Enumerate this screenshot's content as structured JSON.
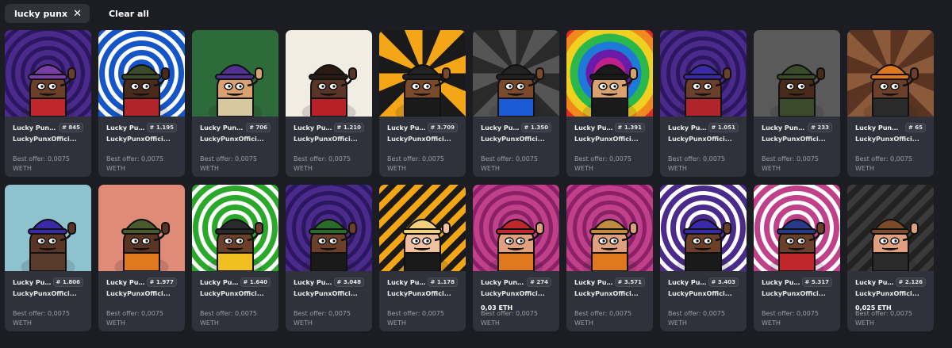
{
  "filters": {
    "chip_label": "lucky punx",
    "clear_label": "Clear all"
  },
  "cards": [
    {
      "name": "Lucky Punx ...",
      "num": "# 845",
      "coll": "LuckyPunxOffici...",
      "price": "",
      "offer": "Best offer: 0,0075",
      "cur": "WETH",
      "bg": "#4a2a8a",
      "bg2": "#2a1760",
      "pattern": "spiral",
      "hat": "#7a3ea8",
      "shirt": "#c0272d",
      "skin": "#6b3f2a"
    },
    {
      "name": "Lucky Punx...",
      "num": "# 1.195",
      "coll": "LuckyPunxOffici...",
      "price": "",
      "offer": "Best offer: 0,0075",
      "cur": "WETH",
      "bg": "#1456c8",
      "bg2": "#ffffff",
      "pattern": "spiral",
      "hat": "#3a4a2a",
      "shirt": "#b0242a",
      "skin": "#4a2a1a"
    },
    {
      "name": "Lucky Punx ...",
      "num": "# 706",
      "coll": "LuckyPunxOffici...",
      "price": "",
      "offer": "Best offer: 0,0075",
      "cur": "WETH",
      "bg": "#2d6b3a",
      "bg2": "#2d6b3a",
      "pattern": "flat",
      "hat": "#503090",
      "shirt": "#d7c8a0",
      "skin": "#d9a070"
    },
    {
      "name": "Lucky Punx...",
      "num": "# 1.210",
      "coll": "LuckyPunxOffici...",
      "price": "",
      "offer": "Best offer: 0,0075",
      "cur": "WETH",
      "bg": "#f1ede2",
      "bg2": "#f1ede2",
      "pattern": "flat",
      "hat": "#2a1a14",
      "shirt": "#b82028",
      "skin": "#5a3525"
    },
    {
      "name": "Lucky Punx...",
      "num": "# 3.709",
      "coll": "LuckyPunxOffici...",
      "price": "",
      "offer": "Best offer: 0,0075",
      "cur": "WETH",
      "bg": "#f4a617",
      "bg2": "#1a1a1a",
      "pattern": "rays",
      "hat": "#222222",
      "shirt": "#1a1a1a",
      "skin": "#7a4a2a"
    },
    {
      "name": "Lucky Punx...",
      "num": "# 1.350",
      "coll": "LuckyPunxOffici...",
      "price": "",
      "offer": "Best offer: 0,0075",
      "cur": "WETH",
      "bg": "#555555",
      "bg2": "#2a2a2a",
      "pattern": "rays",
      "hat": "#222222",
      "shirt": "#1b5bd6",
      "skin": "#7a4a2a"
    },
    {
      "name": "Lucky Punx...",
      "num": "# 1.391",
      "coll": "LuckyPunxOffici...",
      "price": "",
      "offer": "Best offer: 0,0075",
      "cur": "WETH",
      "bg": "#e02a2a",
      "bg2": "#6a1ba8",
      "pattern": "rainbow",
      "hat": "#1a1a1a",
      "shirt": "#1a1a1a",
      "skin": "#d9a070"
    },
    {
      "name": "Lucky Punx...",
      "num": "# 1.051",
      "coll": "LuckyPunxOffici...",
      "price": "",
      "offer": "Best offer: 0,0075",
      "cur": "WETH",
      "bg": "#4a2a8a",
      "bg2": "#2a1760",
      "pattern": "spiral",
      "hat": "#3a2aa8",
      "shirt": "#b0242a",
      "skin": "#6b3f2a"
    },
    {
      "name": "Lucky Punx ...",
      "num": "# 233",
      "coll": "LuckyPunxOffici...",
      "price": "",
      "offer": "Best offer: 0,0075",
      "cur": "WETH",
      "bg": "#5a5a5a",
      "bg2": "#5a5a5a",
      "pattern": "flat",
      "hat": "#3a4a2a",
      "shirt": "#3a4a2a",
      "skin": "#4a2a1a"
    },
    {
      "name": "Lucky Punx 1...",
      "num": "# 65",
      "coll": "LuckyPunxOffici...",
      "price": "",
      "offer": "Best offer: 0,0075",
      "cur": "WETH",
      "bg": "#8a5a3a",
      "bg2": "#5a3420",
      "pattern": "rays",
      "hat": "#e0781e",
      "shirt": "#2a2a2a",
      "skin": "#6b3f2a"
    },
    {
      "name": "Lucky Punx...",
      "num": "# 1.806",
      "coll": "LuckyPunxOffici...",
      "price": "",
      "offer": "Best offer: 0,0075",
      "cur": "WETH",
      "bg": "#8ec2cf",
      "bg2": "#8ec2cf",
      "pattern": "flat",
      "hat": "#3a2aa8",
      "shirt": "#5a3a2a",
      "skin": "#5a3525"
    },
    {
      "name": "Lucky Punx...",
      "num": "# 1.977",
      "coll": "LuckyPunxOffici...",
      "price": "",
      "offer": "Best offer: 0,0075",
      "cur": "WETH",
      "bg": "#e08a78",
      "bg2": "#e08a78",
      "pattern": "flat",
      "hat": "#4a5a2a",
      "shirt": "#e0781e",
      "skin": "#5a3525"
    },
    {
      "name": "Lucky Punx...",
      "num": "# 1.640",
      "coll": "LuckyPunxOffici...",
      "price": "",
      "offer": "Best offer: 0,0075",
      "cur": "WETH",
      "bg": "#2aa82a",
      "bg2": "#ffffff",
      "pattern": "spiral",
      "hat": "#2a2a2a",
      "shirt": "#f0c020",
      "skin": "#6b3f2a"
    },
    {
      "name": "Lucky Punx...",
      "num": "# 3.048",
      "coll": "LuckyPunxOffici...",
      "price": "",
      "offer": "Best offer: 0,0075",
      "cur": "WETH",
      "bg": "#4a2a8a",
      "bg2": "#2a1760",
      "pattern": "spiral",
      "hat": "#2a6a2a",
      "shirt": "#1a1a1a",
      "skin": "#6b3f2a"
    },
    {
      "name": "Lucky Punx...",
      "num": "# 1.178",
      "coll": "LuckyPunxOffici...",
      "price": "",
      "offer": "Best offer: 0,0075",
      "cur": "WETH",
      "bg": "#f4a617",
      "bg2": "#1a1a1a",
      "pattern": "stripes",
      "hat": "#f0d080",
      "shirt": "#1a1a1a",
      "skin": "#f0c0a0"
    },
    {
      "name": "Lucky Punx ...",
      "num": "# 274",
      "coll": "LuckyPunxOffici...",
      "price": "0,03 ETH",
      "offer": "Best offer: 0,0075",
      "cur": "WETH",
      "bg": "#c0408a",
      "bg2": "#8a2068",
      "pattern": "spiral",
      "hat": "#c0272d",
      "shirt": "#e0781e",
      "skin": "#e0a080"
    },
    {
      "name": "Lucky Punx...",
      "num": "# 3.571",
      "coll": "LuckyPunxOffici...",
      "price": "",
      "offer": "Best offer: 0,0075",
      "cur": "WETH",
      "bg": "#c0408a",
      "bg2": "#8a2068",
      "pattern": "spiral",
      "hat": "#c08a40",
      "shirt": "#e0781e",
      "skin": "#e0a080"
    },
    {
      "name": "Lucky Punx...",
      "num": "# 3.403",
      "coll": "LuckyPunxOffici...",
      "price": "",
      "offer": "Best offer: 0,0075",
      "cur": "WETH",
      "bg": "#4a2a8a",
      "bg2": "#ffffff",
      "pattern": "spiral",
      "hat": "#3a2aa8",
      "shirt": "#1a1a1a",
      "skin": "#6b3f2a"
    },
    {
      "name": "Lucky Punx...",
      "num": "# 5.317",
      "coll": "LuckyPunxOffici...",
      "price": "",
      "offer": "Best offer: 0,0075",
      "cur": "WETH",
      "bg": "#c0408a",
      "bg2": "#ffffff",
      "pattern": "spiral",
      "hat": "#2a3a8a",
      "shirt": "#c0272d",
      "skin": "#6b3f2a"
    },
    {
      "name": "Lucky Punx...",
      "num": "# 2.126",
      "coll": "LuckyPunxOffici...",
      "price": "0,025 ETH",
      "offer": "Best offer: 0,0075",
      "cur": "WETH",
      "bg": "#3a3a3a",
      "bg2": "#222222",
      "pattern": "stripes",
      "hat": "#7a4a2a",
      "shirt": "#2a2a2a",
      "skin": "#e0a080"
    }
  ]
}
